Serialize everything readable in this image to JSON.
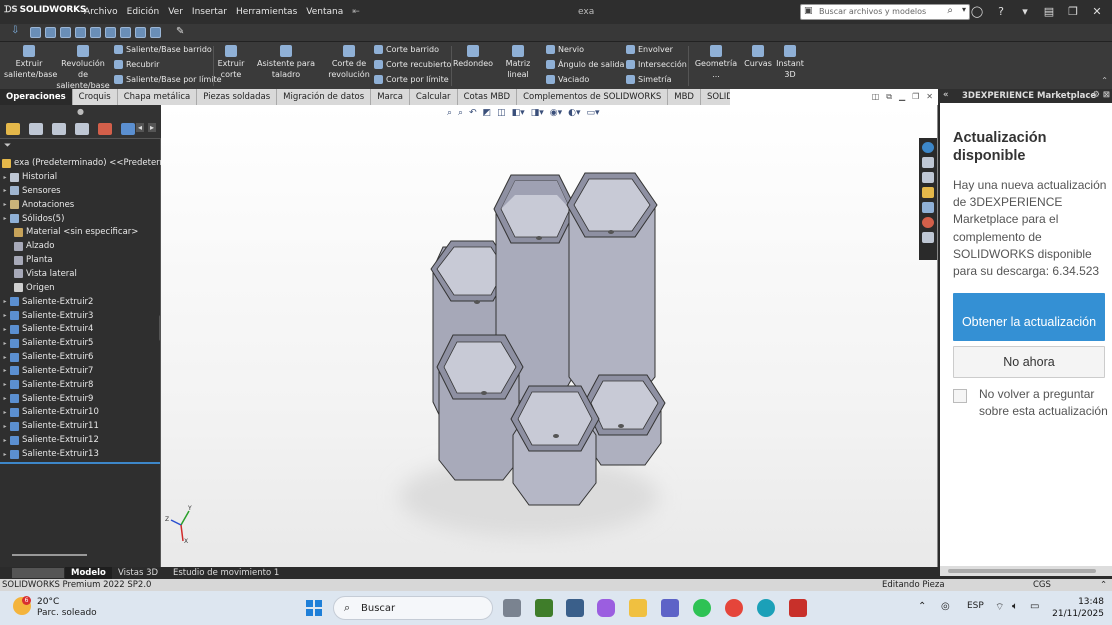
{
  "titlebar": {
    "app_name": "SOLIDWORKS",
    "menus": [
      "Archivo",
      "Edición",
      "Ver",
      "Insertar",
      "Herramientas",
      "Ventana"
    ],
    "document_title": "exa",
    "search_placeholder": "Buscar archivos y modelos"
  },
  "ribbon": {
    "extrude_boss": "Extruir saliente/base",
    "revolve_boss": "Revolución de saliente/base",
    "swept_boss": "Saliente/Base barrido",
    "loft_boss": "Recubrir",
    "boundary_boss": "Saliente/Base por límite",
    "extrude_cut": "Extruir corte",
    "hole_wizard": "Asistente para taladro",
    "revolve_cut": "Corte de revolución",
    "swept_cut": "Corte barrido",
    "loft_cut": "Corte recubierto",
    "boundary_cut": "Corte por límite",
    "fillet": "Redondeo",
    "linear_pattern": "Matriz lineal",
    "rib": "Nervio",
    "draft": "Ángulo de salida",
    "shell": "Vaciado",
    "wrap": "Envolver",
    "intersect": "Intersección",
    "mirror": "Simetría",
    "reference_geometry": "Geometría ...",
    "curves": "Curvas",
    "instant3d": "Instant 3D"
  },
  "tabs": [
    "Operaciones",
    "Croquis",
    "Chapa metálica",
    "Piezas soldadas",
    "Migración de datos",
    "Marca",
    "Calcular",
    "Cotas MBD",
    "Complementos de SOLIDWORKS",
    "MBD",
    "SOLIDWORKS CAM"
  ],
  "tree": {
    "root": "exa (Predeterminado) <<Predetermin",
    "items": [
      "Historial",
      "Sensores",
      "Anotaciones",
      "Sólidos(5)",
      "Material <sin especificar>",
      "Alzado",
      "Planta",
      "Vista lateral",
      "Origen",
      "Saliente-Extruir2",
      "Saliente-Extruir3",
      "Saliente-Extruir4",
      "Saliente-Extruir5",
      "Saliente-Extruir6",
      "Saliente-Extruir7",
      "Saliente-Extruir8",
      "Saliente-Extruir9",
      "Saliente-Extruir10",
      "Saliente-Extruir11",
      "Saliente-Extruir12",
      "Saliente-Extruir13"
    ]
  },
  "panel": {
    "header": "3DEXPERIENCE Marketplace",
    "title": "Actualización disponible",
    "body": "Hay una nueva actualización de 3DEXPERIENCE Marketplace para el complemento de SOLIDWORKS disponible para su descarga: 6.34.523",
    "primary_button": "Obtener la actualización",
    "secondary_button": "No ahora",
    "checkbox_label": "No volver a preguntar sobre esta actualización"
  },
  "bottom_tabs": [
    "Modelo",
    "Vistas 3D",
    "Estudio de movimiento 1"
  ],
  "status": {
    "version": "SOLIDWORKS Premium 2022 SP2.0",
    "mode": "Editando Pieza",
    "units": "CGS"
  },
  "taskbar": {
    "weather_temp": "20°C",
    "weather_desc": "Parc. soleado",
    "weather_badge": "6",
    "search": "Buscar",
    "lang": "ESP",
    "time": "13:48",
    "date": "21/11/2025"
  },
  "colors": {
    "accent": "#3490d4",
    "tree_bg": "#2f2f2f",
    "model_face": "#c3c5d2"
  }
}
